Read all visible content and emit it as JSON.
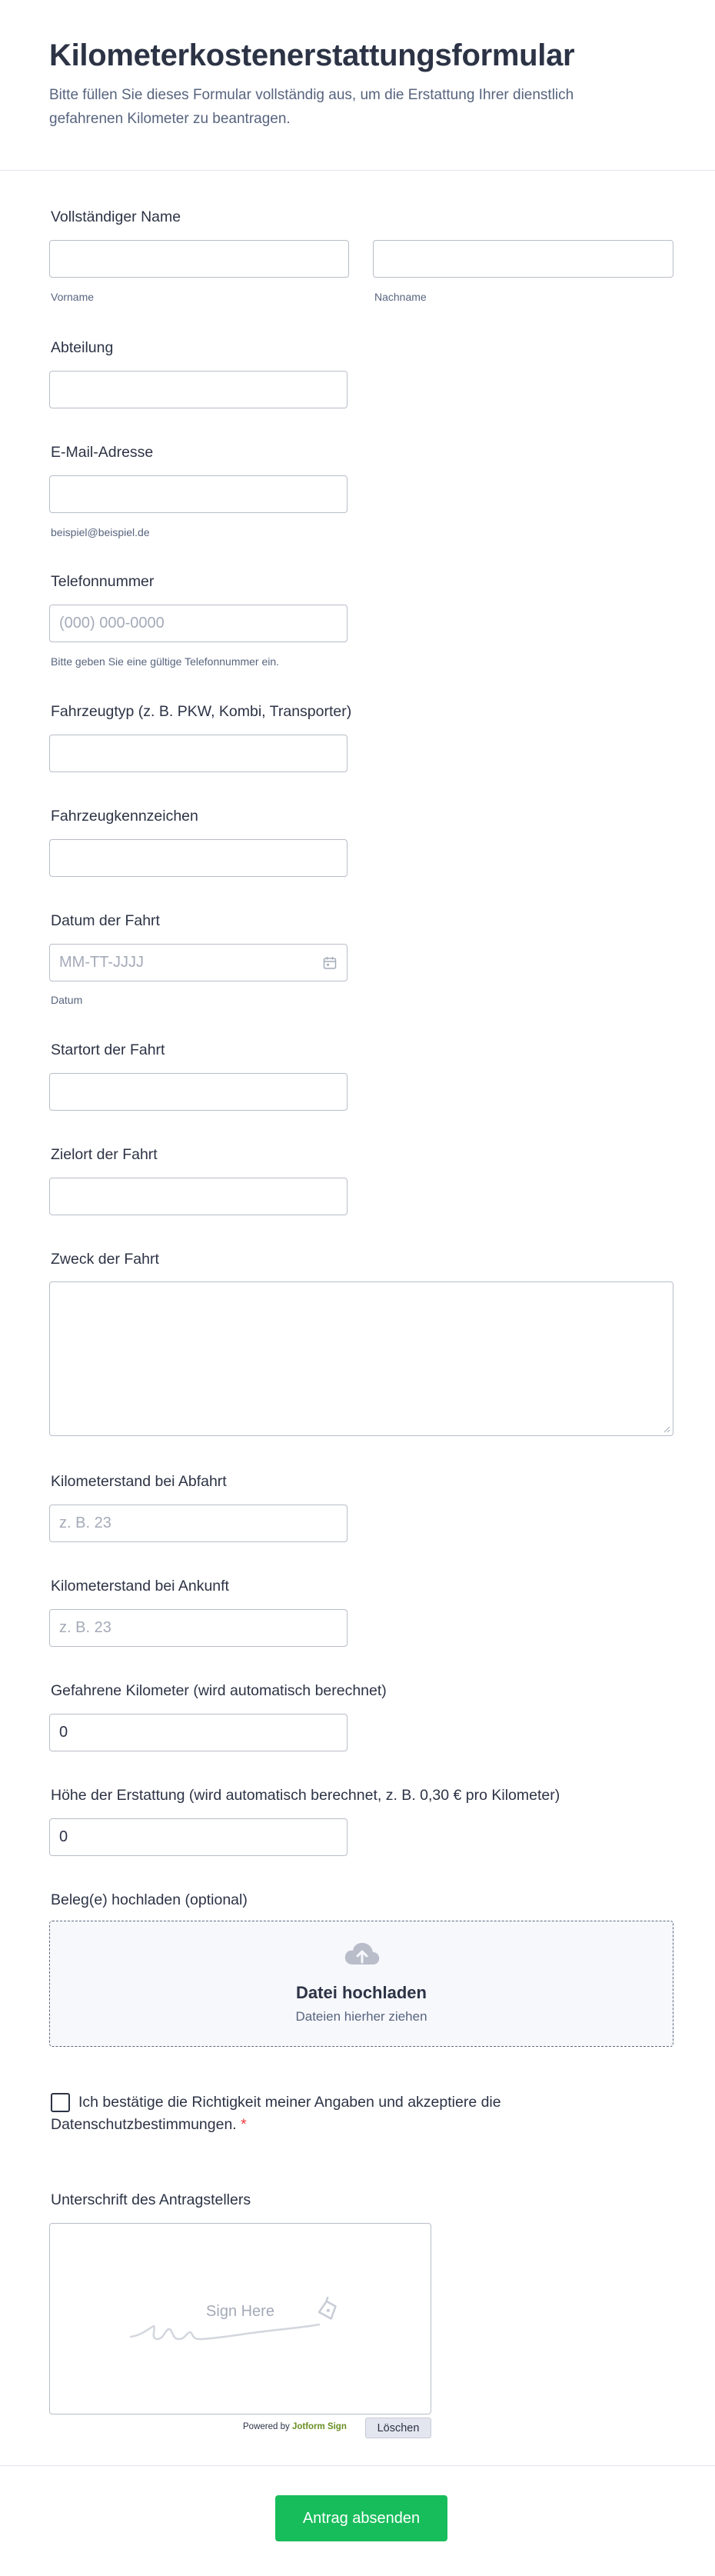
{
  "header": {
    "title": "Kilometerkostenerstattungsformular",
    "description": "Bitte füllen Sie dieses Formular vollständig aus, um die Erstattung Ihrer dienstlich gefahrenen Kilometer zu beantragen."
  },
  "fields": {
    "name": {
      "label": "Vollständiger Name",
      "first_sublabel": "Vorname",
      "last_sublabel": "Nachname"
    },
    "department": {
      "label": "Abteilung"
    },
    "email": {
      "label": "E-Mail-Adresse",
      "sublabel": "beispiel@beispiel.de"
    },
    "phone": {
      "label": "Telefonnummer",
      "placeholder": "(000) 000-0000",
      "sublabel": "Bitte geben Sie eine gültige Telefonnummer ein."
    },
    "vehicle_type": {
      "label": "Fahrzeugtyp (z. B. PKW, Kombi, Transporter)"
    },
    "license_plate": {
      "label": "Fahrzeugkennzeichen"
    },
    "trip_date": {
      "label": "Datum der Fahrt",
      "placeholder": "MM-TT-JJJJ",
      "sublabel": "Datum",
      "icon": "calendar-icon"
    },
    "start_location": {
      "label": "Startort der Fahrt"
    },
    "destination": {
      "label": "Zielort der Fahrt"
    },
    "purpose": {
      "label": "Zweck der Fahrt"
    },
    "odometer_start": {
      "label": "Kilometerstand bei Abfahrt",
      "placeholder": "z. B. 23"
    },
    "odometer_end": {
      "label": "Kilometerstand bei Ankunft",
      "placeholder": "z. B. 23"
    },
    "distance": {
      "label": "Gefahrene Kilometer (wird automatisch berechnet)",
      "value": "0"
    },
    "reimbursement": {
      "label": "Höhe der Erstattung (wird automatisch berechnet, z. B. 0,30 € pro Kilometer)",
      "value": "0"
    },
    "upload": {
      "label": "Beleg(e) hochladen (optional)",
      "title": "Datei hochladen",
      "subtitle": "Dateien hierher ziehen",
      "icon": "cloud-upload-icon"
    },
    "consent": {
      "text": "Ich bestätige die Richtigkeit meiner Angaben und akzeptiere die Datenschutzbestimmungen.",
      "required_mark": "*"
    },
    "signature": {
      "label": "Unterschrift des Antragstellers",
      "placeholder": "Sign Here",
      "powered_by_prefix": "Powered by",
      "powered_by_brand": "Jotform Sign",
      "clear_label": "Löschen"
    }
  },
  "submit": {
    "label": "Antrag absenden"
  },
  "colors": {
    "primary_text": "#2c3345",
    "secondary_text": "#57647e",
    "submit_green": "#18bd5b",
    "required_red": "#f23a3c",
    "border": "#b8bdc9"
  }
}
